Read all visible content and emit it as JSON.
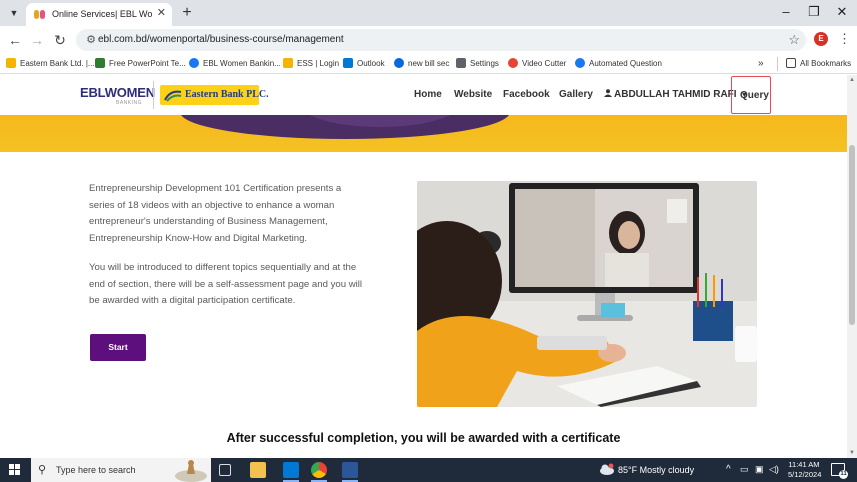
{
  "browser": {
    "tab": {
      "title": "Online Services| EBL Women Ba"
    },
    "url": "ebl.com.bd/womenportal/business-course/management",
    "profile_initial": "E",
    "bookmarks": [
      {
        "label": "Eastern Bank Ltd. |...",
        "color": "#f4b400"
      },
      {
        "label": "Free PowerPoint Te...",
        "color": "#2e7d32"
      },
      {
        "label": "EBL Women Bankin...",
        "color": "#1877f2"
      },
      {
        "label": "ESS | Login",
        "color": "#f4b400"
      },
      {
        "label": "Outlook",
        "color": "#0078d4"
      },
      {
        "label": "new bill sec",
        "color": "#0668e1"
      },
      {
        "label": "Settings",
        "color": "#5f6368"
      },
      {
        "label": "Video Cutter",
        "color": "#ea4335"
      },
      {
        "label": "Automated Question",
        "color": "#1877f2"
      }
    ],
    "bookmarks_overflow": "»",
    "all_bookmarks": "All Bookmarks"
  },
  "site": {
    "logo": {
      "ebl": "EBL",
      "women": "WOMEN",
      "banking": "BANKING",
      "eastern_bank": "Eastern Bank PLC."
    },
    "nav": {
      "home": "Home",
      "website": "Website",
      "facebook": "Facebook",
      "gallery": "Gallery",
      "user": "ABDULLAH TAHMID RAFI",
      "user_caret": "▾",
      "query": "Query"
    }
  },
  "course": {
    "description_1": "Entrepreneurship Development 101 Certification presents a series of 18 videos with an objective to enhance a woman entrepreneur's understanding of Business Management, Entrepreneurship Know-How and Digital Marketing.",
    "description_2": "You will be introduced to different topics sequentially and at the end of section, there will be a self-assessment page and you will be awarded with a digital participation certificate.",
    "start_button": "Start",
    "certificate_heading": "After successful completion, you will be awarded with a certificate"
  },
  "taskbar": {
    "search_placeholder": "Type here to search",
    "weather": "85°F  Mostly cloudy",
    "time": "11:41 AM",
    "date": "5/12/2024",
    "notifications": "11"
  },
  "colors": {
    "brand_purple": "#5e0f7e",
    "brand_yellow": "#f4c224",
    "query_border": "#e14b5a"
  }
}
